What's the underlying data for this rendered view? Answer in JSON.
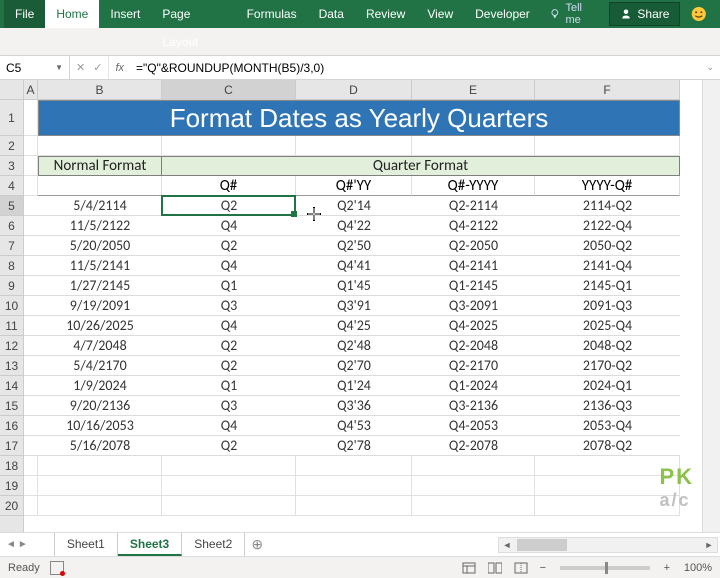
{
  "ribbon": {
    "tabs": [
      "File",
      "Home",
      "Insert",
      "Page Layout",
      "Formulas",
      "Data",
      "Review",
      "View",
      "Developer"
    ],
    "tellme": "Tell me",
    "share": "Share"
  },
  "namebox": "C5",
  "formula": "=\"Q\"&ROUNDUP(MONTH(B5)/3,0)",
  "cols": [
    "A",
    "B",
    "C",
    "D",
    "E",
    "F"
  ],
  "rows": [
    "1",
    "2",
    "3",
    "4",
    "5",
    "6",
    "7",
    "8",
    "9",
    "10",
    "11",
    "12",
    "13",
    "14",
    "15",
    "16",
    "17",
    "18",
    "19",
    "20"
  ],
  "title": "Format Dates as Yearly Quarters",
  "headers": {
    "normal": "Normal Format",
    "quarter": "Quarter Format"
  },
  "subheaders": [
    "Q#",
    "Q#'YY",
    "Q#-YYYY",
    "YYYY-Q#"
  ],
  "data": [
    [
      "5/4/2114",
      "Q2",
      "Q2'14",
      "Q2-2114",
      "2114-Q2"
    ],
    [
      "11/5/2122",
      "Q4",
      "Q4'22",
      "Q4-2122",
      "2122-Q4"
    ],
    [
      "5/20/2050",
      "Q2",
      "Q2'50",
      "Q2-2050",
      "2050-Q2"
    ],
    [
      "11/5/2141",
      "Q4",
      "Q4'41",
      "Q4-2141",
      "2141-Q4"
    ],
    [
      "1/27/2145",
      "Q1",
      "Q1'45",
      "Q1-2145",
      "2145-Q1"
    ],
    [
      "9/19/2091",
      "Q3",
      "Q3'91",
      "Q3-2091",
      "2091-Q3"
    ],
    [
      "10/26/2025",
      "Q4",
      "Q4'25",
      "Q4-2025",
      "2025-Q4"
    ],
    [
      "4/7/2048",
      "Q2",
      "Q2'48",
      "Q2-2048",
      "2048-Q2"
    ],
    [
      "5/4/2170",
      "Q2",
      "Q2'70",
      "Q2-2170",
      "2170-Q2"
    ],
    [
      "1/9/2024",
      "Q1",
      "Q1'24",
      "Q1-2024",
      "2024-Q1"
    ],
    [
      "9/20/2136",
      "Q3",
      "Q3'36",
      "Q3-2136",
      "2136-Q3"
    ],
    [
      "10/16/2053",
      "Q4",
      "Q4'53",
      "Q4-2053",
      "2053-Q4"
    ],
    [
      "5/16/2078",
      "Q2",
      "Q2'78",
      "Q2-2078",
      "2078-Q2"
    ]
  ],
  "sheets": [
    "Sheet1",
    "Sheet3",
    "Sheet2"
  ],
  "active_sheet": 1,
  "active_col": 2,
  "active_row": 4,
  "status": {
    "ready": "Ready",
    "zoom": "100%"
  },
  "watermark": {
    "line1": "PK",
    "line2": "a/c"
  }
}
